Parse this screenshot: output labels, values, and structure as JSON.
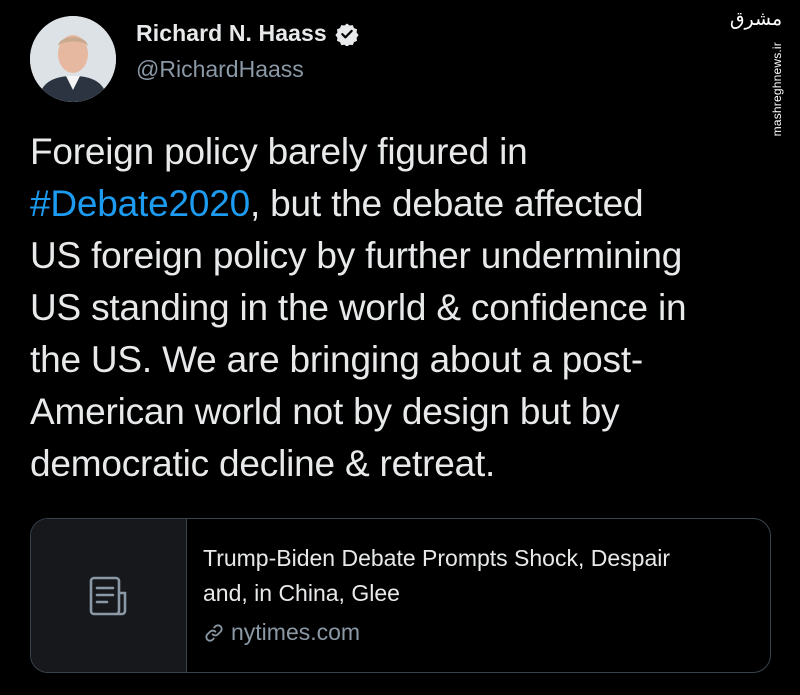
{
  "author": {
    "name": "Richard N. Haass",
    "handle": "@RichardHaass",
    "verified": true,
    "avatar_icon": "profile-photo"
  },
  "watermark": {
    "logo_text": "مشرق",
    "url": "mashreghnews.ir"
  },
  "tweet": {
    "lines": [
      "Foreign policy barely figured in",
      "#Debate2020",
      ", but the debate affected",
      "US foreign policy by further undermining",
      "US standing in the world & confidence in",
      "the US. We are bringing about a post-",
      "American world not by design but by",
      "democratic decline & retreat."
    ],
    "hashtag": "#Debate2020"
  },
  "link_card": {
    "title_line1": "Trump-Biden Debate Prompts Shock, Despair",
    "title_line2": "and, in China, Glee",
    "domain": "nytimes.com",
    "thumb_icon": "document-icon",
    "domain_icon": "link-icon"
  },
  "colors": {
    "background": "#000000",
    "text": "#e7e9ea",
    "secondary": "#8b98a5",
    "hashtag": "#1d9bf0",
    "border": "#38444d"
  }
}
